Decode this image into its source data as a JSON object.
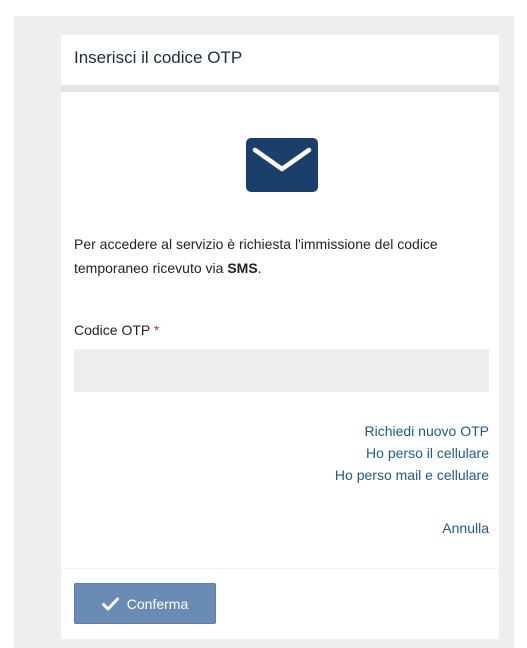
{
  "dialog": {
    "title": "Inserisci il codice OTP",
    "icon": "envelope-icon",
    "message_prefix": "Per accedere al servizio è richiesta l'immissione del codice temporaneo ricevuto via ",
    "message_emphasis": "SMS",
    "message_suffix": "."
  },
  "form": {
    "otp_label": "Codice OTP",
    "required_marker": "*",
    "otp_value": "",
    "otp_placeholder": ""
  },
  "links": {
    "request_new_otp": "Richiedi nuovo OTP",
    "lost_phone": "Ho perso il cellulare",
    "lost_mail_and_phone": "Ho perso mail e cellulare",
    "cancel": "Annulla"
  },
  "footer": {
    "confirm_label": "Conferma",
    "confirm_icon": "check-icon"
  },
  "colors": {
    "accent": "#1f5a8f",
    "icon": "#1b3f6b",
    "button": "#6a8cb4",
    "required": "#c0392b"
  }
}
